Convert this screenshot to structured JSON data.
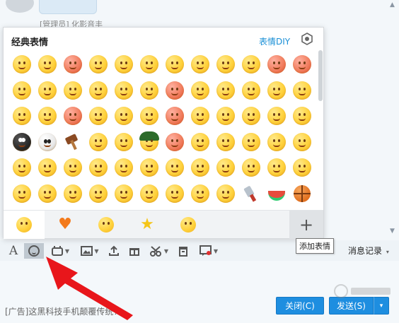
{
  "chat": {
    "sender_name": "[管理员] 化影音丰"
  },
  "emoji_panel": {
    "title": "经典表情",
    "diy_link": "表情DIY",
    "settings_icon": "hexagon-gear-icon",
    "rows": 6,
    "cols": 12,
    "tabs": [
      {
        "icon": "smiley-face-icon",
        "active": true
      },
      {
        "icon": "orange-heart-icon",
        "active": false
      },
      {
        "icon": "grin-face-icon",
        "active": false
      },
      {
        "icon": "star-icon",
        "active": false
      },
      {
        "icon": "laughing-face-icon",
        "active": false
      }
    ],
    "add_tab_label": "+"
  },
  "tooltip": {
    "text": "添加表情"
  },
  "toolbar": {
    "history_label": "消息记录",
    "history_caret": "▾",
    "icons": [
      "font-icon",
      "emoji-icon",
      "gif-icon",
      "image-icon",
      "upload-icon",
      "gift-icon",
      "scissors-icon",
      "file-icon",
      "feedback-icon"
    ]
  },
  "footer": {
    "ad_text": "[广告]这黑科技手机颠覆传统！",
    "close_button": "关闭(C)",
    "send_button": "发送(S)",
    "send_dropdown_caret": "▾"
  },
  "colors": {
    "accent": "#1e8ee0",
    "diy_link": "#1a8fd6",
    "arrow": "#e8161b",
    "emoji_yellow": "#ffd23d"
  }
}
